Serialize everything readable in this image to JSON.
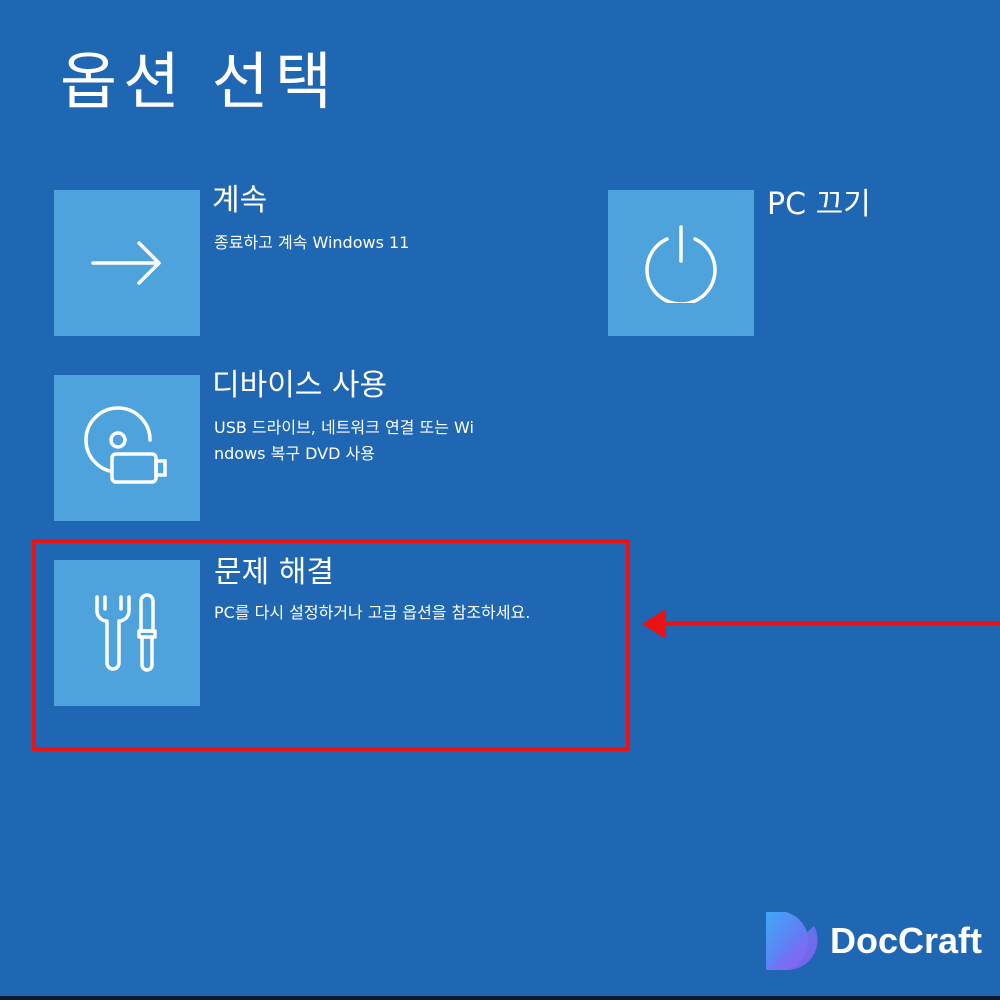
{
  "page_title": "옵션 선택",
  "options": [
    {
      "title": "계속",
      "desc_lines": [
        "종료하고 계속 Windows 11"
      ],
      "icon": "arrow-right-icon"
    },
    {
      "title": "PC 끄기",
      "desc_lines": [],
      "icon": "power-icon"
    },
    {
      "title": "디바이스 사용",
      "desc_lines": [
        "USB 드라이브, 네트워크 연결 또는 Wi",
        "ndows 복구 DVD 사용"
      ],
      "icon": "disc-usb-icon"
    },
    {
      "title": "문제 해결",
      "desc_lines": [
        "PC를 다시 설정하거나 고급 옵션을 참조하세요."
      ],
      "icon": "wrench-screwdriver-icon"
    }
  ],
  "logo": {
    "text": "DocCraft"
  },
  "colors": {
    "background": "#1f66b3",
    "tile": "#4ea3dc",
    "highlight": "#ee1111"
  }
}
